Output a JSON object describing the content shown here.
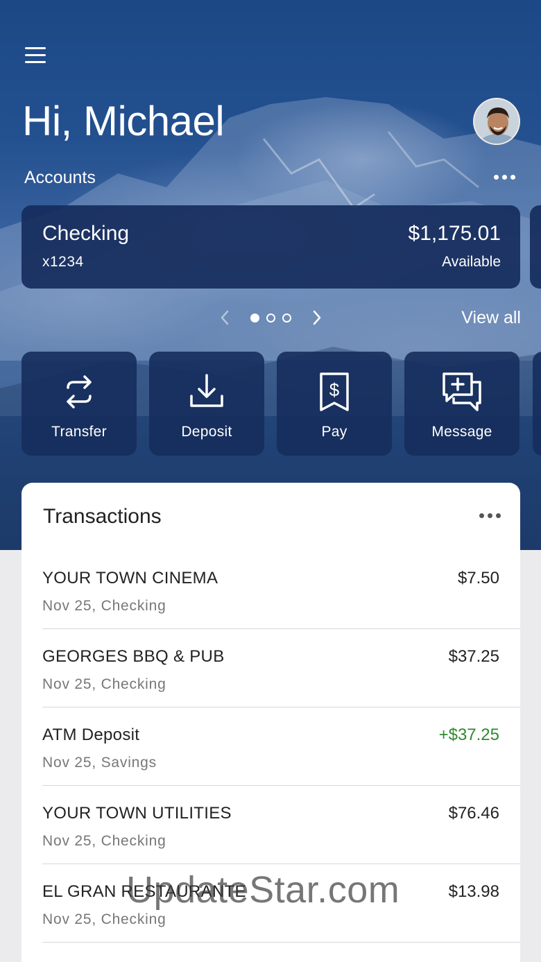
{
  "header": {
    "greeting": "Hi, Michael",
    "accounts_label": "Accounts",
    "menu_icon": "hamburger-menu-icon",
    "more_icon": "more-horizontal-icon"
  },
  "account_card": {
    "name": "Checking",
    "number": "x1234",
    "balance": "$1,175.01",
    "balance_label": "Available"
  },
  "pager": {
    "page_count": 3,
    "current_page": 1,
    "view_all_label": "View all"
  },
  "actions": [
    {
      "label": "Transfer",
      "icon": "transfer-icon"
    },
    {
      "label": "Deposit",
      "icon": "deposit-icon"
    },
    {
      "label": "Pay",
      "icon": "pay-bill-icon"
    },
    {
      "label": "Message",
      "icon": "message-icon"
    }
  ],
  "transactions": {
    "title": "Transactions",
    "items": [
      {
        "name": "YOUR TOWN CINEMA",
        "sub": "Nov 25, Checking",
        "amount": "$7.50",
        "credit": false
      },
      {
        "name": "GEORGES BBQ & PUB",
        "sub": "Nov 25, Checking",
        "amount": "$37.25",
        "credit": false
      },
      {
        "name": "ATM Deposit",
        "sub": "Nov 25, Savings",
        "amount": "+$37.25",
        "credit": true
      },
      {
        "name": "YOUR TOWN UTILITIES",
        "sub": "Nov 25, Checking",
        "amount": "$76.46",
        "credit": false
      },
      {
        "name": "EL GRAN RESTAURANTE",
        "sub": "Nov 25, Checking",
        "amount": "$13.98",
        "credit": false
      }
    ]
  },
  "watermark": "UpdateStar.com",
  "colors": {
    "hero_blue": "#23508f",
    "card_navy": "#162d5c",
    "credit_green": "#2e8a2e"
  }
}
